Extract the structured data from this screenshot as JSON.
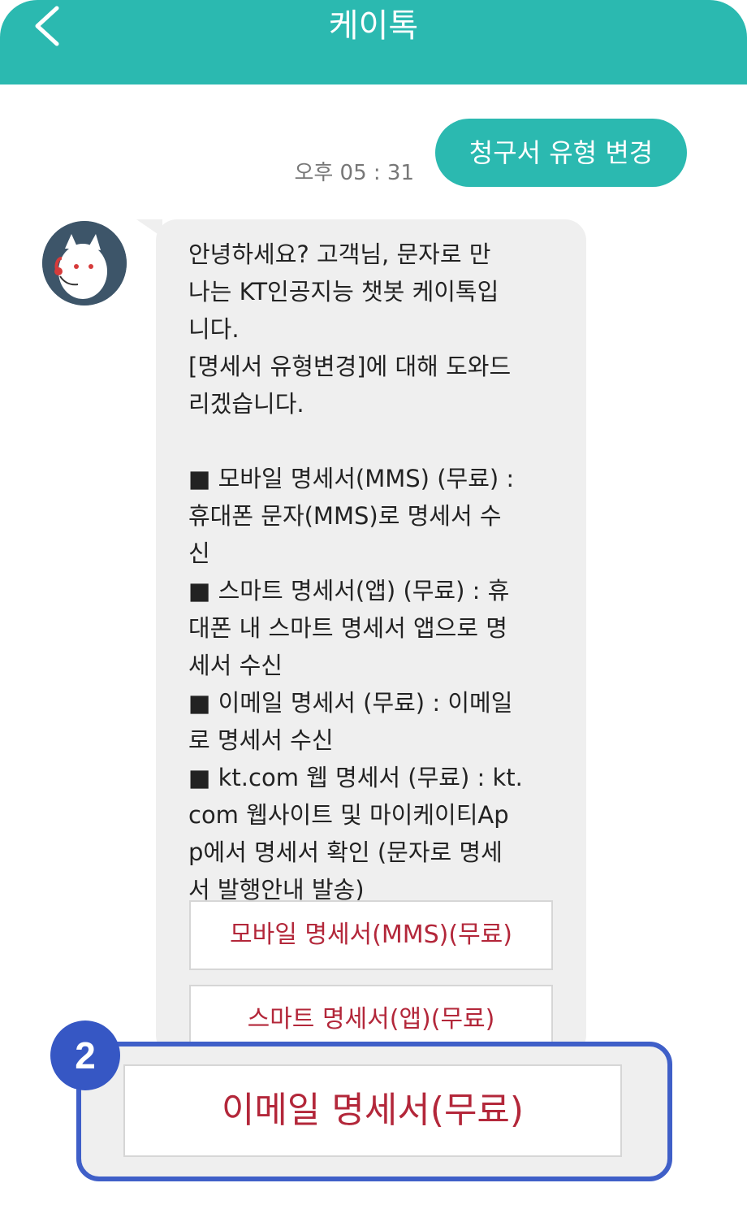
{
  "header": {
    "title": "케이톡",
    "back_icon": "chevron-left-icon",
    "background_color": "#2bb9b0"
  },
  "user_message": {
    "text": "청구서 유형 변경",
    "time": "오후 05 : 31"
  },
  "bot_message": {
    "avatar_icon": "kt-bot-avatar-icon",
    "text": "안녕하세요? 고객님, 문자로 만\n나는 KT인공지능 챗봇 케이톡입\n니다.\n[명세서 유형변경]에 대해 도와드\n리겠습니다.\n\n■ 모바일 명세서(MMS) (무료) :\n휴대폰 문자(MMS)로 명세서 수\n신\n■ 스마트 명세서(앱) (무료) : 휴\n대폰 내 스마트 명세서 앱으로 명\n세서 수신\n■ 이메일 명세서 (무료) : 이메일\n로 명세서 수신\n■ kt.com 웹 명세서 (무료) : kt.\ncom 웹사이트 및 마이케이티Ap\np에서 명세서 확인 (문자로 명세\n서 발행안내 발송)"
  },
  "options": [
    {
      "label": "모바일 명세서(MMS)(무료)"
    },
    {
      "label": "스마트 명세서(앱)(무료)"
    },
    {
      "label": "이메일 명세서(무료)"
    }
  ],
  "highlight": {
    "step_number": "2",
    "border_color": "#3f5fc8"
  }
}
